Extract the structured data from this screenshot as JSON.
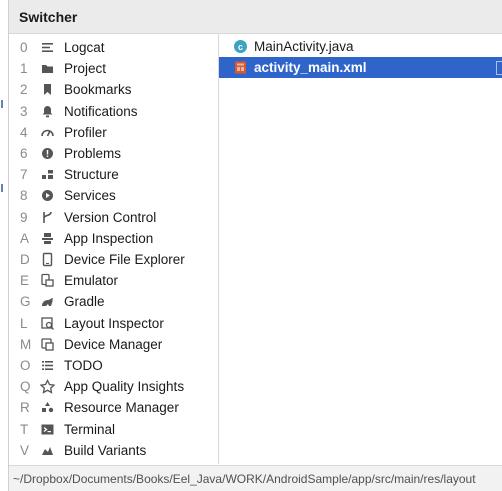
{
  "title": "Switcher",
  "tools": [
    {
      "key": "0",
      "label": "Logcat",
      "icon": "logcat-icon"
    },
    {
      "key": "1",
      "label": "Project",
      "icon": "folder-icon"
    },
    {
      "key": "2",
      "label": "Bookmarks",
      "icon": "bookmark-icon"
    },
    {
      "key": "3",
      "label": "Notifications",
      "icon": "bell-icon"
    },
    {
      "key": "4",
      "label": "Profiler",
      "icon": "profiler-gauge-icon"
    },
    {
      "key": "6",
      "label": "Problems",
      "icon": "problems-icon"
    },
    {
      "key": "7",
      "label": "Structure",
      "icon": "structure-icon"
    },
    {
      "key": "8",
      "label": "Services",
      "icon": "services-icon"
    },
    {
      "key": "9",
      "label": "Version Control",
      "icon": "version-control-icon"
    },
    {
      "key": "A",
      "label": "App Inspection",
      "icon": "app-inspection-icon"
    },
    {
      "key": "D",
      "label": "Device File Explorer",
      "icon": "device-icon"
    },
    {
      "key": "E",
      "label": "Emulator",
      "icon": "emulator-icon"
    },
    {
      "key": "G",
      "label": "Gradle",
      "icon": "gradle-icon"
    },
    {
      "key": "L",
      "label": "Layout Inspector",
      "icon": "layout-inspector-icon"
    },
    {
      "key": "M",
      "label": "Device Manager",
      "icon": "device-manager-icon"
    },
    {
      "key": "O",
      "label": "TODO",
      "icon": "todo-list-icon"
    },
    {
      "key": "Q",
      "label": "App Quality Insights",
      "icon": "app-quality-icon"
    },
    {
      "key": "R",
      "label": "Resource Manager",
      "icon": "resource-manager-icon"
    },
    {
      "key": "T",
      "label": "Terminal",
      "icon": "terminal-icon"
    },
    {
      "key": "V",
      "label": "Build Variants",
      "icon": "build-variants-icon"
    }
  ],
  "files": [
    {
      "label": "MainActivity.java",
      "icon": "java-class-icon",
      "selected": false
    },
    {
      "label": "activity_main.xml",
      "icon": "layout-xml-icon",
      "selected": true
    }
  ],
  "path": "~/Dropbox/Documents/Books/Eel_Java/WORK/AndroidSample/app/src/main/res/layout",
  "colors": {
    "selection": "#2f65ca",
    "header": "#ebebeb",
    "java_icon": "#3ba3c4",
    "xml_icon": "#d35a35"
  }
}
